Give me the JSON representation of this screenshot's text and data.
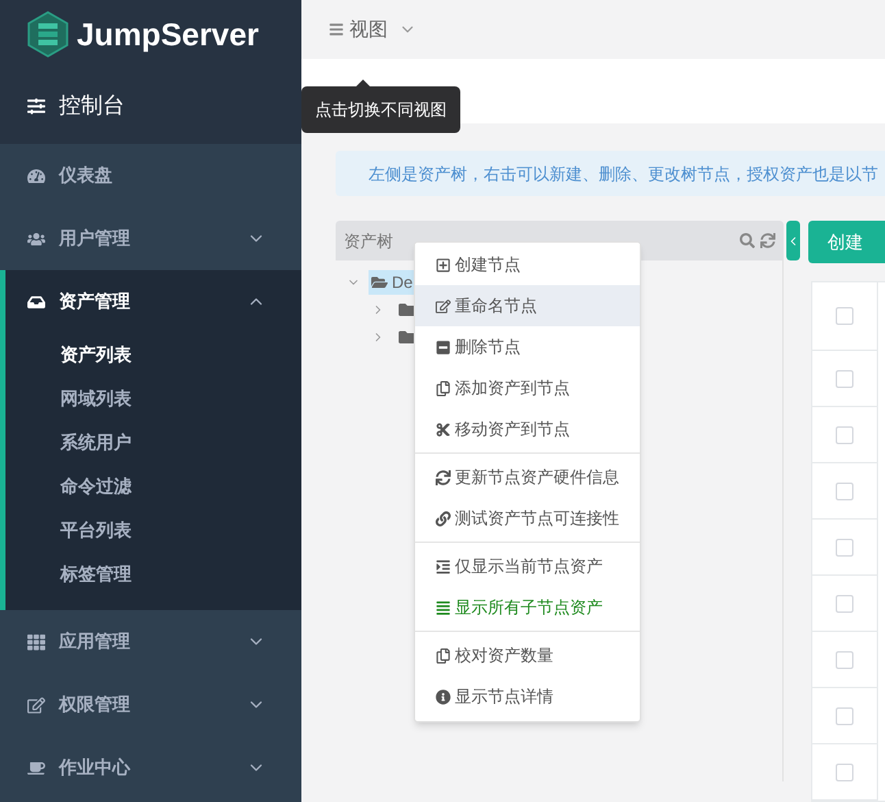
{
  "brand": {
    "name": "JumpServer"
  },
  "sidebar": {
    "console": "控制台",
    "items": [
      {
        "label": "仪表盘",
        "expandable": false,
        "expanded": false
      },
      {
        "label": "用户管理",
        "expandable": true,
        "expanded": false
      },
      {
        "label": "资产管理",
        "expandable": true,
        "expanded": true,
        "children": [
          {
            "label": "资产列表",
            "selected": true
          },
          {
            "label": "网域列表",
            "selected": false
          },
          {
            "label": "系统用户",
            "selected": false
          },
          {
            "label": "命令过滤",
            "selected": false
          },
          {
            "label": "平台列表",
            "selected": false
          },
          {
            "label": "标签管理",
            "selected": false
          }
        ]
      },
      {
        "label": "应用管理",
        "expandable": true,
        "expanded": false
      },
      {
        "label": "权限管理",
        "expandable": true,
        "expanded": false
      },
      {
        "label": "作业中心",
        "expandable": true,
        "expanded": false
      }
    ]
  },
  "header": {
    "view_menu": "视图"
  },
  "tooltip": "点击切换不同视图",
  "info": "左侧是资产树，右击可以新建、删除、更改树节点，授权资产也是以节",
  "tree": {
    "title": "资产树",
    "nodes": [
      {
        "label": "De",
        "selected": true,
        "expanded": true,
        "children": [
          {
            "expanded": false
          },
          {
            "expanded": false
          }
        ]
      }
    ]
  },
  "create_button": "创建",
  "table": {
    "header_checked": false,
    "rows": [
      {
        "checked": false
      },
      {
        "checked": false
      },
      {
        "checked": false
      },
      {
        "checked": false
      },
      {
        "checked": false
      },
      {
        "checked": false
      },
      {
        "checked": false
      },
      {
        "checked": false
      }
    ]
  },
  "context_menu": {
    "groups": [
      [
        {
          "label": "创建节点",
          "highlighted": false,
          "active": false
        },
        {
          "label": "重命名节点",
          "highlighted": true,
          "active": false
        },
        {
          "label": "删除节点",
          "highlighted": false,
          "active": false
        },
        {
          "label": "添加资产到节点",
          "highlighted": false,
          "active": false
        },
        {
          "label": "移动资产到节点",
          "highlighted": false,
          "active": false
        }
      ],
      [
        {
          "label": "更新节点资产硬件信息",
          "highlighted": false,
          "active": false
        },
        {
          "label": "测试资产节点可连接性",
          "highlighted": false,
          "active": false
        }
      ],
      [
        {
          "label": "仅显示当前节点资产",
          "highlighted": false,
          "active": false
        },
        {
          "label": "显示所有子节点资产",
          "highlighted": false,
          "active": true
        }
      ],
      [
        {
          "label": "校对资产数量",
          "highlighted": false,
          "active": false
        },
        {
          "label": "显示节点详情",
          "highlighted": false,
          "active": false
        }
      ]
    ]
  }
}
